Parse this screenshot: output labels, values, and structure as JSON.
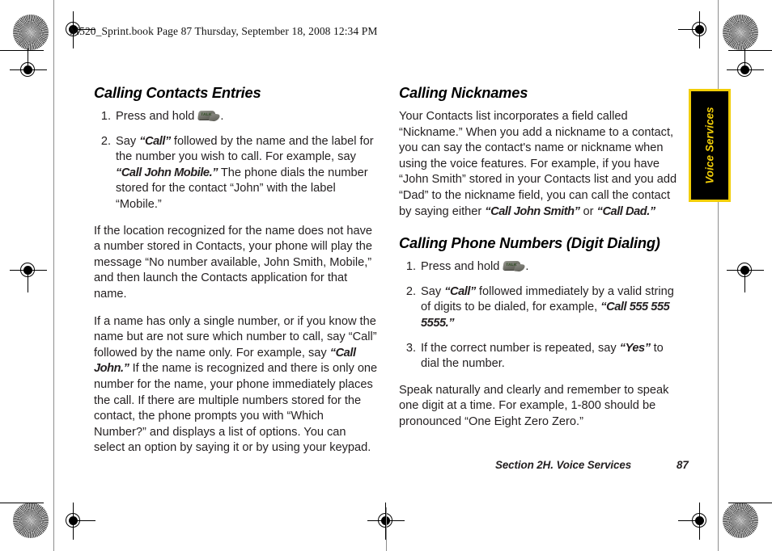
{
  "header": {
    "text": "M520_Sprint.book  Page 87  Thursday, September 18, 2008  12:34 PM"
  },
  "side_tab": {
    "label": "Voice Services",
    "background_color": "#000000",
    "border_color": "#F2CE08",
    "text_color": "#F2CE08"
  },
  "footer": {
    "section": "Section 2H. Voice Services",
    "page_number": "87"
  },
  "left_column": {
    "heading": "Calling Contacts Entries",
    "steps": [
      {
        "num": "1.",
        "parts": [
          {
            "type": "text",
            "value": "Press and hold "
          },
          {
            "type": "icon",
            "value": "talk-key-icon",
            "label": "TALK"
          },
          {
            "type": "text",
            "value": "."
          }
        ]
      },
      {
        "num": "2.",
        "parts": [
          {
            "type": "text",
            "value": "Say "
          },
          {
            "type": "quote",
            "value": "“Call”"
          },
          {
            "type": "text",
            "value": " followed by the name and the label for the number you wish to call. For example, say "
          },
          {
            "type": "quote",
            "value": "“Call John Mobile.”"
          },
          {
            "type": "text",
            "value": " The phone dials the number stored for the contact “John” with the label “Mobile.”"
          }
        ]
      }
    ],
    "paragraphs": [
      {
        "parts": [
          {
            "type": "text",
            "value": "If the location recognized for the name does not have a number stored in Contacts, your phone will play the message “No number available, John Smith, Mobile,” and then launch the Contacts application for that name."
          }
        ]
      },
      {
        "parts": [
          {
            "type": "text",
            "value": "If a name has only a single number, or if you know the name but are not sure which number to call, say “Call” followed by the name only. For example, say "
          },
          {
            "type": "quote",
            "value": "“Call John.”"
          },
          {
            "type": "text",
            "value": " If the name is recognized and there is only one number for the name, your phone immediately places the call. If there are multiple numbers stored for the contact, the phone prompts you with “Which Number?” and displays a list of options. You can select an option by saying it or by using your keypad."
          }
        ]
      }
    ]
  },
  "right_column": {
    "heading_nicknames": "Calling Nicknames",
    "nicknames_paragraph": {
      "parts": [
        {
          "type": "text",
          "value": "Your Contacts list incorporates a field called “Nickname.” When you add a nickname to a contact, you can say the contact's name or nickname when using the voice features. For example, if you have “John Smith” stored in your Contacts list and you add “Dad” to the nickname field, you can call the contact by saying either "
        },
        {
          "type": "quote",
          "value": "“Call John Smith”"
        },
        {
          "type": "text",
          "value": " or "
        },
        {
          "type": "quote",
          "value": "“Call Dad.”"
        }
      ]
    },
    "heading_digit_dialing": "Calling Phone Numbers (Digit Dialing)",
    "steps": [
      {
        "num": "1.",
        "parts": [
          {
            "type": "text",
            "value": "Press and hold "
          },
          {
            "type": "icon",
            "value": "talk-key-icon",
            "label": "TALK"
          },
          {
            "type": "text",
            "value": "."
          }
        ]
      },
      {
        "num": "2.",
        "parts": [
          {
            "type": "text",
            "value": "Say "
          },
          {
            "type": "quote",
            "value": "“Call”"
          },
          {
            "type": "text",
            "value": " followed immediately by a valid string of digits to be dialed, for example, "
          },
          {
            "type": "quote",
            "value": "“Call 555 555 5555.”"
          }
        ]
      },
      {
        "num": "3.",
        "parts": [
          {
            "type": "text",
            "value": "If the correct number is repeated, say "
          },
          {
            "type": "quote",
            "value": "“Yes”"
          },
          {
            "type": "text",
            "value": " to dial the number."
          }
        ]
      }
    ],
    "closing_paragraph": {
      "parts": [
        {
          "type": "text",
          "value": "Speak naturally and clearly and remember to speak one digit at a time. For example, 1-800 should be pronounced “One Eight Zero Zero.”"
        }
      ]
    }
  }
}
